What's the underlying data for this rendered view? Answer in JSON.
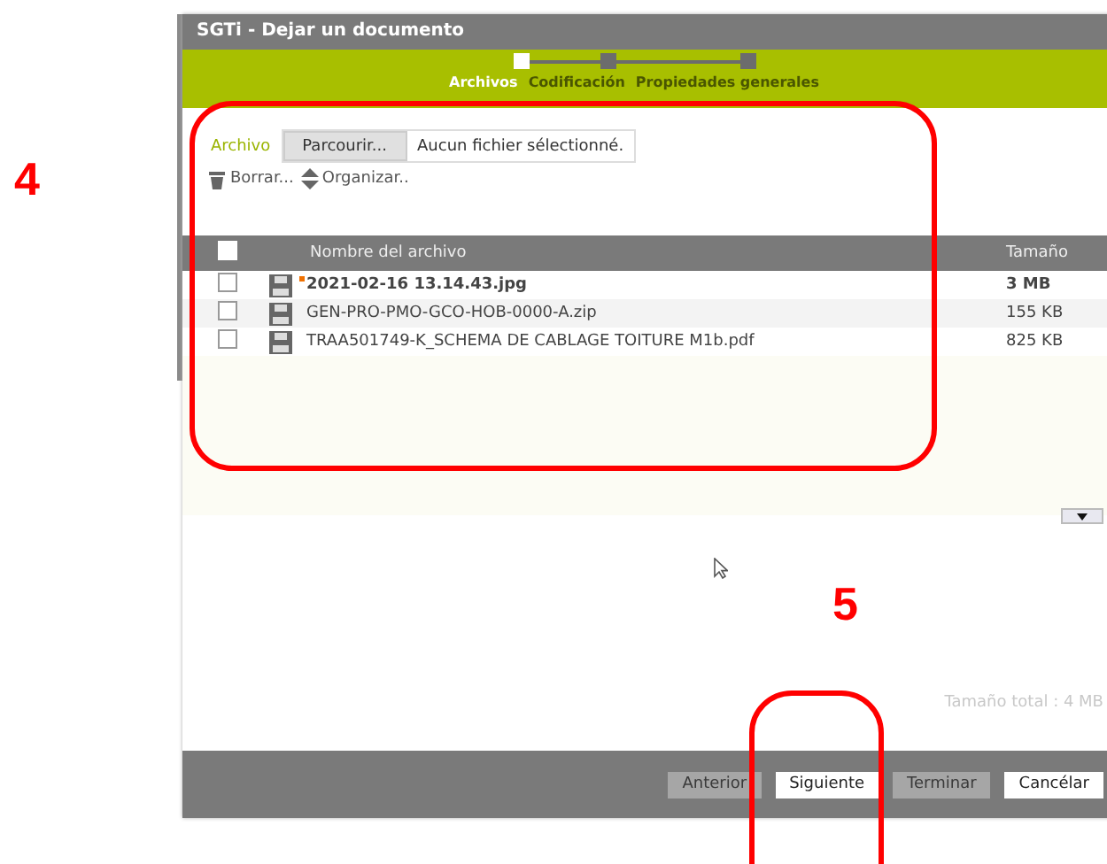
{
  "window": {
    "title": "SGTi - Dejar un documento"
  },
  "steps": [
    {
      "label": "Archivos",
      "selected": true
    },
    {
      "label": "Codificación",
      "selected": false
    },
    {
      "label": "Propiedades generales",
      "selected": false
    }
  ],
  "file_field": {
    "label": "Archivo",
    "button": "Parcourir...",
    "value": "Aucun fichier sélectionné."
  },
  "toolbar": [
    {
      "label": "Borrar...",
      "kind": "delete"
    },
    {
      "label": "Organizar..",
      "kind": "sort"
    }
  ],
  "table": {
    "select_all_checked": false,
    "columns": [
      "Nombre del archivo",
      "Tamaño"
    ],
    "rows": [
      {
        "name": "2021-02-16 13.14.43.jpg",
        "size": "3 MB",
        "checked": false,
        "new": true
      },
      {
        "name": "GEN-PRO-PMO-GCO-HOB-0000-A.zip",
        "size": "155 KB",
        "checked": false,
        "new": false
      },
      {
        "name": "TRAA501749-K_SCHEMA DE CABLAGE TOITURE M1b.pdf",
        "size": "825 KB",
        "checked": false,
        "new": false
      }
    ]
  },
  "total": "Tamaño total : 4 MB",
  "buttons": [
    {
      "label": "Anterior",
      "disabled": true
    },
    {
      "label": "Siguiente",
      "disabled": false
    },
    {
      "label": "Terminar",
      "disabled": true
    },
    {
      "label": "Cancélar",
      "disabled": false
    }
  ],
  "annotations": [
    {
      "label": "4"
    },
    {
      "label": "5"
    }
  ]
}
